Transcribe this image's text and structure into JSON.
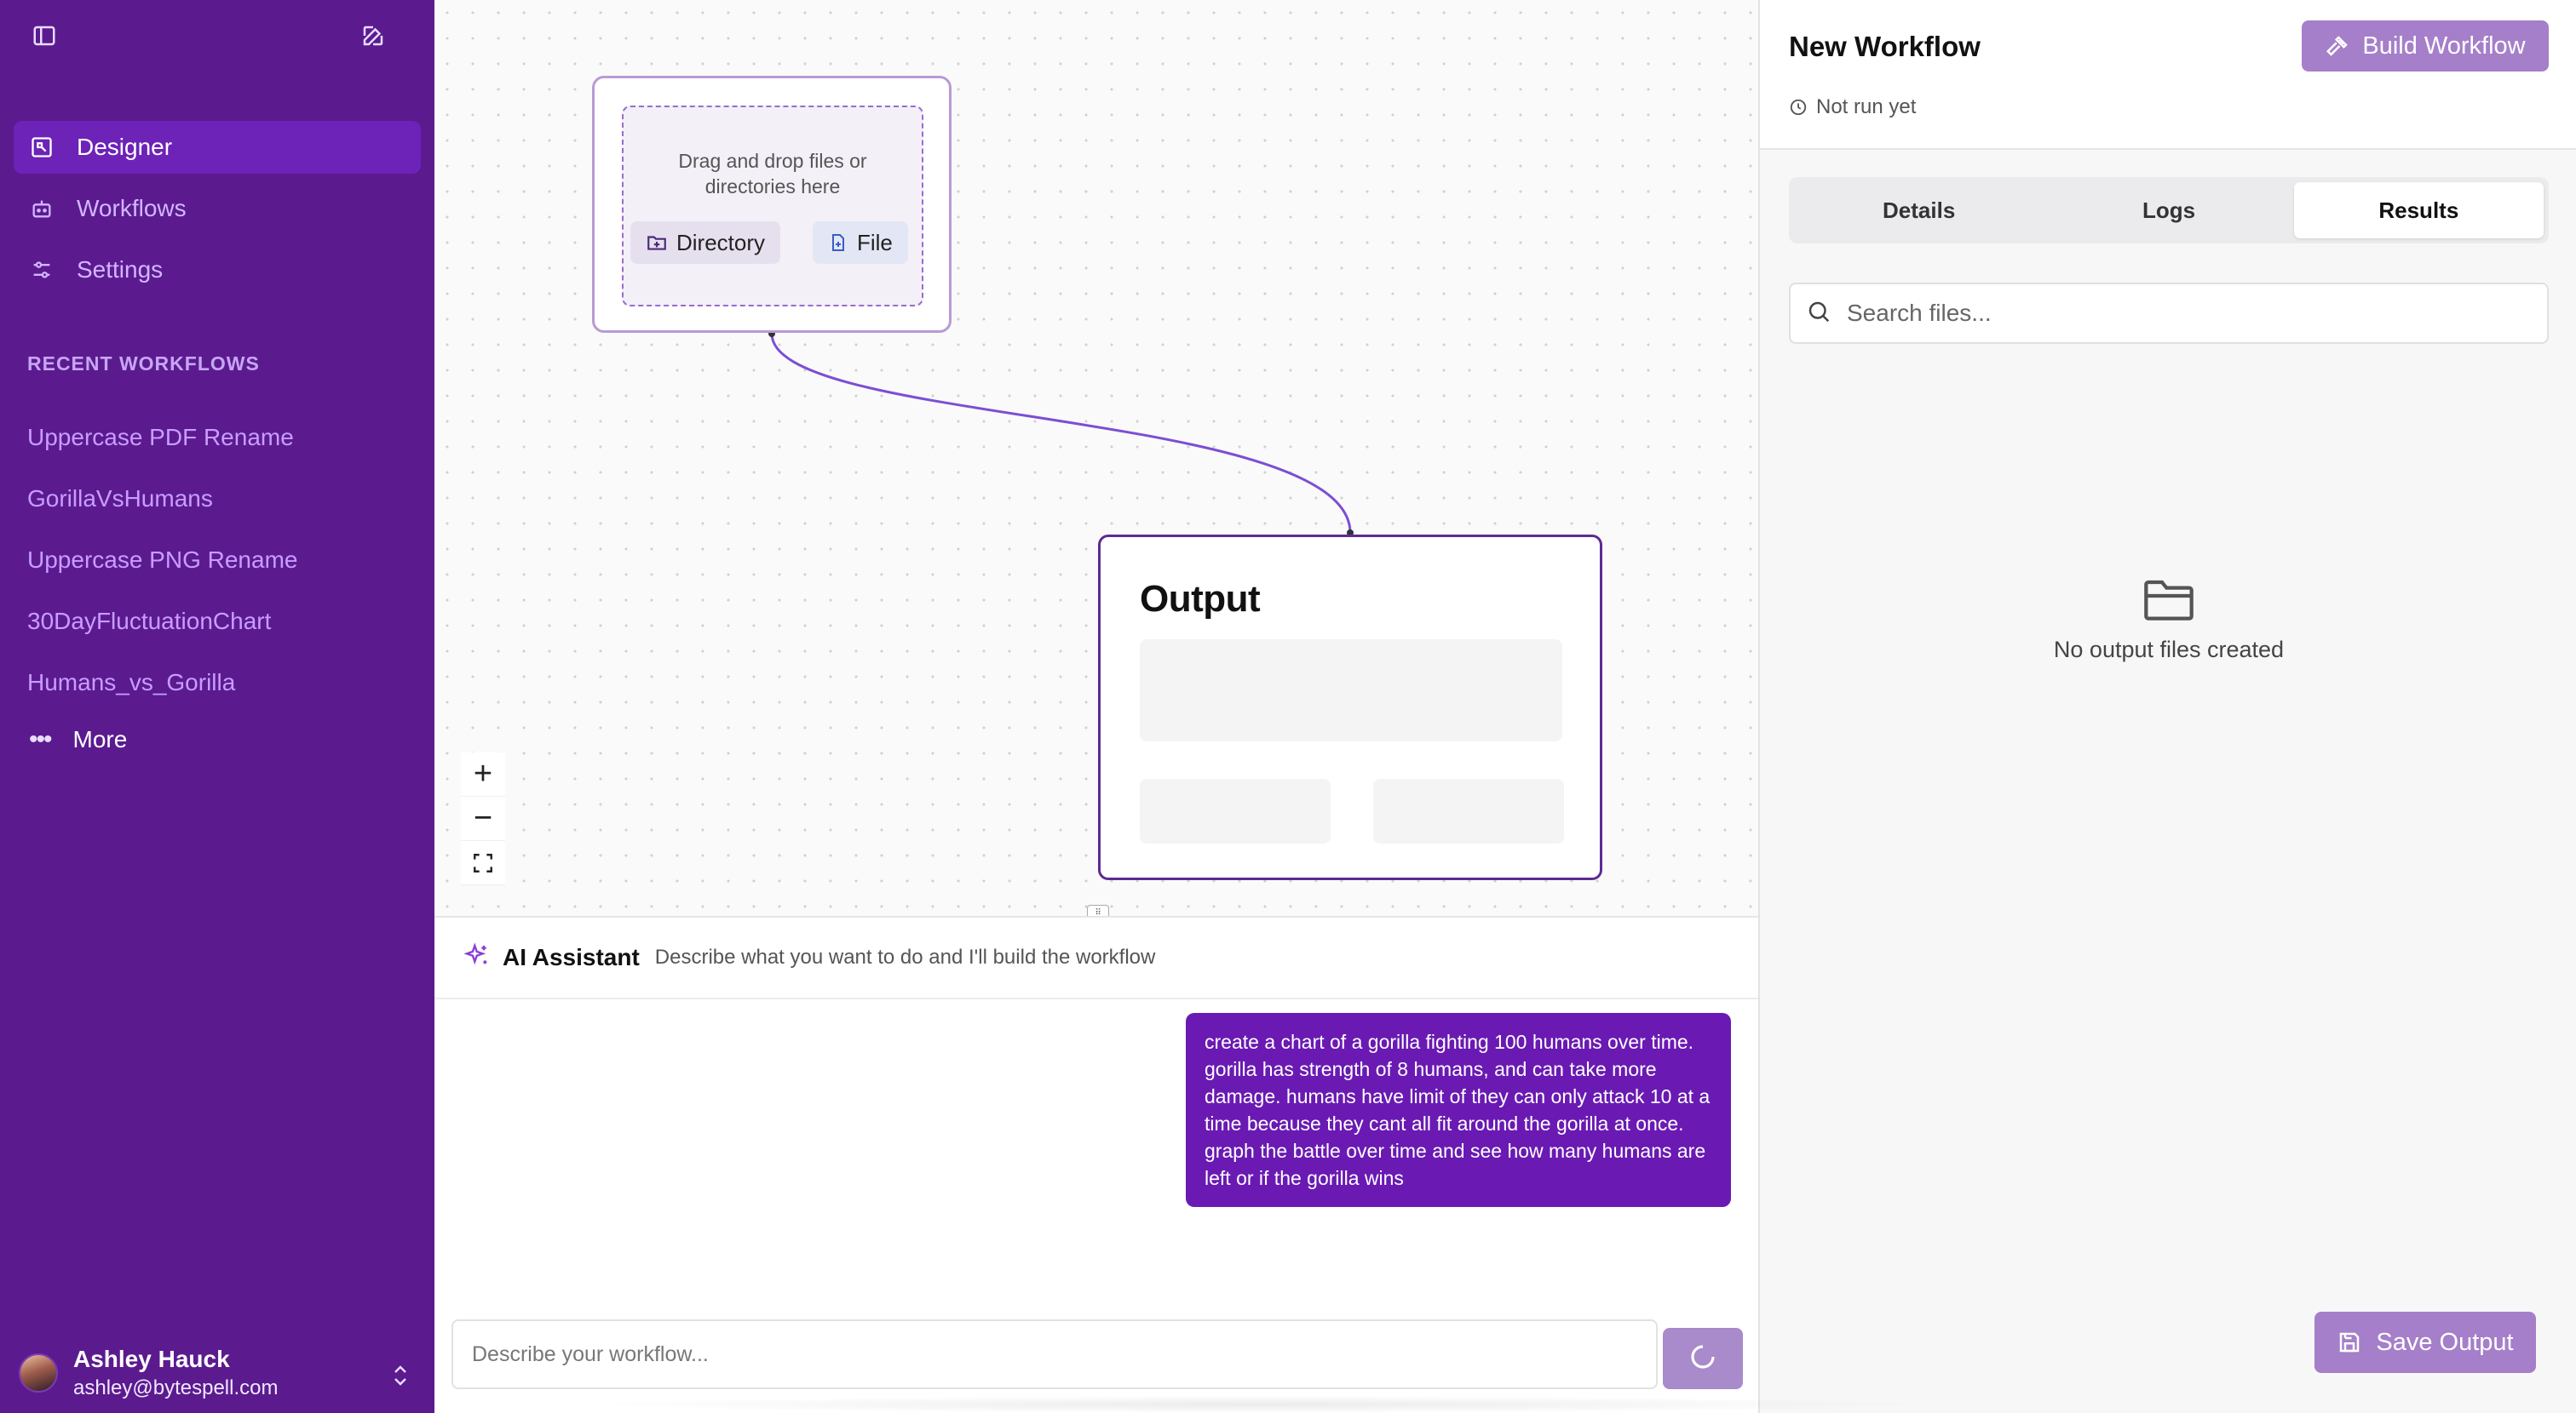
{
  "sidebar": {
    "nav": [
      {
        "label": "Designer",
        "icon": "designer-icon",
        "active": true
      },
      {
        "label": "Workflows",
        "icon": "bot-icon",
        "active": false
      },
      {
        "label": "Settings",
        "icon": "sliders-icon",
        "active": false
      }
    ],
    "recent_header": "RECENT WORKFLOWS",
    "recent": [
      "Uppercase PDF Rename",
      "GorillaVsHumans",
      "Uppercase PNG Rename",
      "30DayFluctuationChart",
      "Humans_vs_Gorilla"
    ],
    "more_label": "More",
    "user": {
      "name": "Ashley Hauck",
      "email": "ashley@bytespell.com"
    }
  },
  "canvas": {
    "input_node": {
      "drop_text": "Drag and drop files or directories here",
      "directory_label": "Directory",
      "file_label": "File"
    },
    "output_node": {
      "title": "Output"
    },
    "zoom": {
      "in": "+",
      "out": "−"
    }
  },
  "assistant": {
    "title": "AI Assistant",
    "description": "Describe what you want to do and I'll build the workflow",
    "messages": [
      {
        "role": "user",
        "text": "create a chart of a gorilla fighting 100 humans over time. gorilla has strength of 8 humans, and can take more damage. humans have limit of they can only attack 10 at a time because they cant all fit around the gorilla at once. graph the battle over time and see how many humans are left or if the gorilla wins"
      }
    ],
    "input_placeholder": "Describe your workflow..."
  },
  "panel": {
    "title": "New Workflow",
    "status": "Not run yet",
    "build_label": "Build Workflow",
    "tabs": [
      "Details",
      "Logs",
      "Results"
    ],
    "active_tab": "Results",
    "search_placeholder": "Search files...",
    "empty_text": "No output files created",
    "save_label": "Save Output"
  },
  "colors": {
    "sidebar_bg": "#5b1b8f",
    "active_nav": "#6d22b8",
    "accent": "#7c3aed",
    "bubble": "#6a1ab3",
    "button_muted": "#a57fc9"
  }
}
